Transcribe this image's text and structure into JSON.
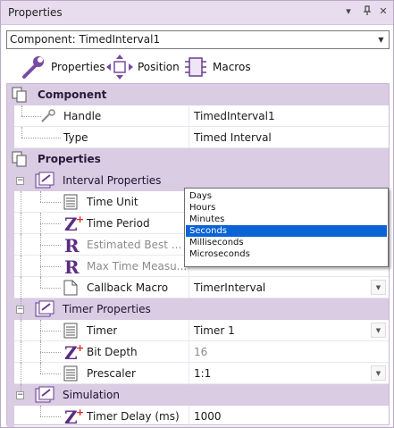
{
  "window": {
    "title": "Properties",
    "controls": {
      "dropdown": "▾",
      "pin": "📌",
      "close": "✕"
    }
  },
  "component_selector": {
    "value": "Component: TimedInterval1"
  },
  "tabs": [
    {
      "label": "Properties",
      "icon": "wrench-icon"
    },
    {
      "label": "Position",
      "icon": "move-arrows-icon"
    },
    {
      "label": "Macros",
      "icon": "chip-icon"
    }
  ],
  "sections": {
    "component": {
      "label": "Component",
      "rows": [
        {
          "name": "Handle",
          "value": "TimedInterval1"
        },
        {
          "name": "Type",
          "value": "Timed Interval"
        }
      ]
    },
    "properties": {
      "label": "Properties",
      "interval": {
        "label": "Interval Properties",
        "rows": [
          {
            "name": "Time Unit",
            "value": ""
          },
          {
            "name": "Time Period",
            "value": ""
          },
          {
            "name": "Estimated Best ...",
            "value": ""
          },
          {
            "name": "Max Time Measu...",
            "value": ""
          },
          {
            "name": "Callback Macro",
            "value": "TimerInterval"
          }
        ]
      },
      "timer": {
        "label": "Timer Properties",
        "rows": [
          {
            "name": "Timer",
            "value": "Timer 1"
          },
          {
            "name": "Bit Depth",
            "value": "16"
          },
          {
            "name": "Prescaler",
            "value": "1:1"
          }
        ]
      },
      "simulation": {
        "label": "Simulation",
        "rows": [
          {
            "name": "Timer Delay (ms)",
            "value": "1000"
          }
        ]
      }
    }
  },
  "time_unit_dropdown": {
    "options": [
      "Days",
      "Hours",
      "Minutes",
      "Seconds",
      "Milliseconds",
      "Microseconds"
    ],
    "selected": "Seconds"
  },
  "colors": {
    "category_bg": "#d9cce3",
    "title_bg": "#e8ddef",
    "selection": "#0a64d6",
    "disabled_text": "#8b8b8b"
  }
}
